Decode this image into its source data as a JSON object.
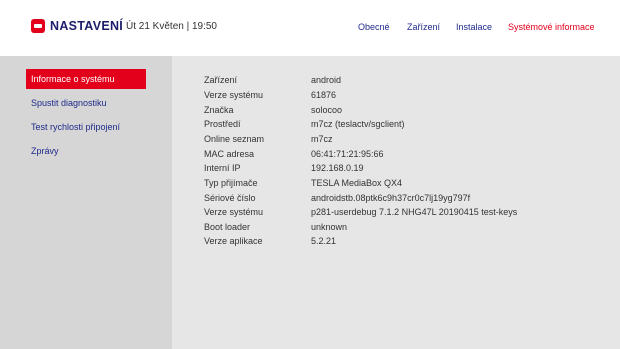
{
  "header": {
    "logo_text": "NASTAVENÍ",
    "datetime": "Út 21 Květen | 19:50",
    "nav": [
      {
        "label": "Obecné",
        "active": false
      },
      {
        "label": "Zařízení",
        "active": false
      },
      {
        "label": "Instalace",
        "active": false
      },
      {
        "label": "Systémové informace",
        "active": true
      }
    ]
  },
  "sidebar": {
    "items": [
      {
        "label": "Informace o systému",
        "active": true
      },
      {
        "label": "Spustit diagnostiku",
        "active": false
      },
      {
        "label": "Test rychlosti připojení",
        "active": false
      },
      {
        "label": "Zprávy",
        "active": false
      }
    ]
  },
  "info": [
    {
      "label": "Zařízení",
      "value": "android"
    },
    {
      "label": "Verze systému",
      "value": "61876"
    },
    {
      "label": "Značka",
      "value": "solocoo"
    },
    {
      "label": "Prostředí",
      "value": "m7cz (teslactv/sgclient)"
    },
    {
      "label": "Online seznam",
      "value": "m7cz"
    },
    {
      "label": "MAC adresa",
      "value": "06:41:71:21:95:66"
    },
    {
      "label": "Interní IP",
      "value": "192.168.0.19"
    },
    {
      "label": "Typ přijímače",
      "value": "TESLA MediaBox QX4"
    },
    {
      "label": "Sériové číslo",
      "value": "androidstb.08ptk6c9h37cr0c7lj19yg797f"
    },
    {
      "label": "Verze systému",
      "value": "p281-userdebug 7.1.2 NHG47L 20190415 test-keys"
    },
    {
      "label": "Boot loader",
      "value": "unknown"
    },
    {
      "label": "Verze aplikace",
      "value": "5.2.21"
    }
  ],
  "colors": {
    "accent": "#e3001b",
    "nav_text": "#1f2a8a",
    "sidebar_bg": "#d6d6d6",
    "content_bg": "#e6e6e6"
  }
}
